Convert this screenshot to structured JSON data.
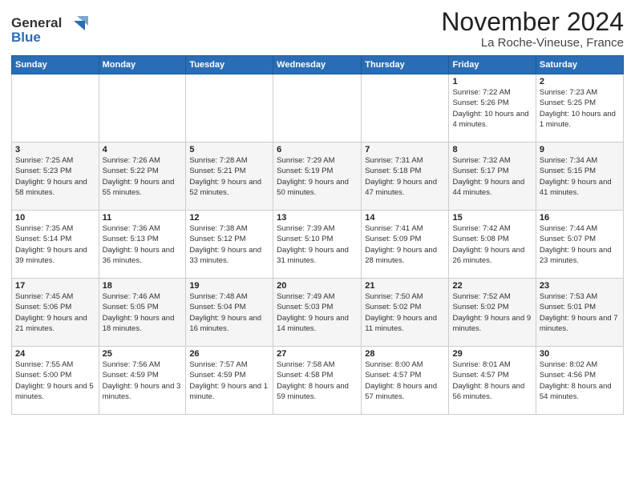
{
  "logo": {
    "line1": "General",
    "line2": "Blue"
  },
  "header": {
    "month": "November 2024",
    "location": "La Roche-Vineuse, France"
  },
  "days_of_week": [
    "Sunday",
    "Monday",
    "Tuesday",
    "Wednesday",
    "Thursday",
    "Friday",
    "Saturday"
  ],
  "weeks": [
    [
      {
        "day": "",
        "sunrise": "",
        "sunset": "",
        "daylight": ""
      },
      {
        "day": "",
        "sunrise": "",
        "sunset": "",
        "daylight": ""
      },
      {
        "day": "",
        "sunrise": "",
        "sunset": "",
        "daylight": ""
      },
      {
        "day": "",
        "sunrise": "",
        "sunset": "",
        "daylight": ""
      },
      {
        "day": "",
        "sunrise": "",
        "sunset": "",
        "daylight": ""
      },
      {
        "day": "1",
        "sunrise": "Sunrise: 7:22 AM",
        "sunset": "Sunset: 5:26 PM",
        "daylight": "Daylight: 10 hours and 4 minutes."
      },
      {
        "day": "2",
        "sunrise": "Sunrise: 7:23 AM",
        "sunset": "Sunset: 5:25 PM",
        "daylight": "Daylight: 10 hours and 1 minute."
      }
    ],
    [
      {
        "day": "3",
        "sunrise": "Sunrise: 7:25 AM",
        "sunset": "Sunset: 5:23 PM",
        "daylight": "Daylight: 9 hours and 58 minutes."
      },
      {
        "day": "4",
        "sunrise": "Sunrise: 7:26 AM",
        "sunset": "Sunset: 5:22 PM",
        "daylight": "Daylight: 9 hours and 55 minutes."
      },
      {
        "day": "5",
        "sunrise": "Sunrise: 7:28 AM",
        "sunset": "Sunset: 5:21 PM",
        "daylight": "Daylight: 9 hours and 52 minutes."
      },
      {
        "day": "6",
        "sunrise": "Sunrise: 7:29 AM",
        "sunset": "Sunset: 5:19 PM",
        "daylight": "Daylight: 9 hours and 50 minutes."
      },
      {
        "day": "7",
        "sunrise": "Sunrise: 7:31 AM",
        "sunset": "Sunset: 5:18 PM",
        "daylight": "Daylight: 9 hours and 47 minutes."
      },
      {
        "day": "8",
        "sunrise": "Sunrise: 7:32 AM",
        "sunset": "Sunset: 5:17 PM",
        "daylight": "Daylight: 9 hours and 44 minutes."
      },
      {
        "day": "9",
        "sunrise": "Sunrise: 7:34 AM",
        "sunset": "Sunset: 5:15 PM",
        "daylight": "Daylight: 9 hours and 41 minutes."
      }
    ],
    [
      {
        "day": "10",
        "sunrise": "Sunrise: 7:35 AM",
        "sunset": "Sunset: 5:14 PM",
        "daylight": "Daylight: 9 hours and 39 minutes."
      },
      {
        "day": "11",
        "sunrise": "Sunrise: 7:36 AM",
        "sunset": "Sunset: 5:13 PM",
        "daylight": "Daylight: 9 hours and 36 minutes."
      },
      {
        "day": "12",
        "sunrise": "Sunrise: 7:38 AM",
        "sunset": "Sunset: 5:12 PM",
        "daylight": "Daylight: 9 hours and 33 minutes."
      },
      {
        "day": "13",
        "sunrise": "Sunrise: 7:39 AM",
        "sunset": "Sunset: 5:10 PM",
        "daylight": "Daylight: 9 hours and 31 minutes."
      },
      {
        "day": "14",
        "sunrise": "Sunrise: 7:41 AM",
        "sunset": "Sunset: 5:09 PM",
        "daylight": "Daylight: 9 hours and 28 minutes."
      },
      {
        "day": "15",
        "sunrise": "Sunrise: 7:42 AM",
        "sunset": "Sunset: 5:08 PM",
        "daylight": "Daylight: 9 hours and 26 minutes."
      },
      {
        "day": "16",
        "sunrise": "Sunrise: 7:44 AM",
        "sunset": "Sunset: 5:07 PM",
        "daylight": "Daylight: 9 hours and 23 minutes."
      }
    ],
    [
      {
        "day": "17",
        "sunrise": "Sunrise: 7:45 AM",
        "sunset": "Sunset: 5:06 PM",
        "daylight": "Daylight: 9 hours and 21 minutes."
      },
      {
        "day": "18",
        "sunrise": "Sunrise: 7:46 AM",
        "sunset": "Sunset: 5:05 PM",
        "daylight": "Daylight: 9 hours and 18 minutes."
      },
      {
        "day": "19",
        "sunrise": "Sunrise: 7:48 AM",
        "sunset": "Sunset: 5:04 PM",
        "daylight": "Daylight: 9 hours and 16 minutes."
      },
      {
        "day": "20",
        "sunrise": "Sunrise: 7:49 AM",
        "sunset": "Sunset: 5:03 PM",
        "daylight": "Daylight: 9 hours and 14 minutes."
      },
      {
        "day": "21",
        "sunrise": "Sunrise: 7:50 AM",
        "sunset": "Sunset: 5:02 PM",
        "daylight": "Daylight: 9 hours and 11 minutes."
      },
      {
        "day": "22",
        "sunrise": "Sunrise: 7:52 AM",
        "sunset": "Sunset: 5:02 PM",
        "daylight": "Daylight: 9 hours and 9 minutes."
      },
      {
        "day": "23",
        "sunrise": "Sunrise: 7:53 AM",
        "sunset": "Sunset: 5:01 PM",
        "daylight": "Daylight: 9 hours and 7 minutes."
      }
    ],
    [
      {
        "day": "24",
        "sunrise": "Sunrise: 7:55 AM",
        "sunset": "Sunset: 5:00 PM",
        "daylight": "Daylight: 9 hours and 5 minutes."
      },
      {
        "day": "25",
        "sunrise": "Sunrise: 7:56 AM",
        "sunset": "Sunset: 4:59 PM",
        "daylight": "Daylight: 9 hours and 3 minutes."
      },
      {
        "day": "26",
        "sunrise": "Sunrise: 7:57 AM",
        "sunset": "Sunset: 4:59 PM",
        "daylight": "Daylight: 9 hours and 1 minute."
      },
      {
        "day": "27",
        "sunrise": "Sunrise: 7:58 AM",
        "sunset": "Sunset: 4:58 PM",
        "daylight": "Daylight: 8 hours and 59 minutes."
      },
      {
        "day": "28",
        "sunrise": "Sunrise: 8:00 AM",
        "sunset": "Sunset: 4:57 PM",
        "daylight": "Daylight: 8 hours and 57 minutes."
      },
      {
        "day": "29",
        "sunrise": "Sunrise: 8:01 AM",
        "sunset": "Sunset: 4:57 PM",
        "daylight": "Daylight: 8 hours and 56 minutes."
      },
      {
        "day": "30",
        "sunrise": "Sunrise: 8:02 AM",
        "sunset": "Sunset: 4:56 PM",
        "daylight": "Daylight: 8 hours and 54 minutes."
      }
    ]
  ]
}
